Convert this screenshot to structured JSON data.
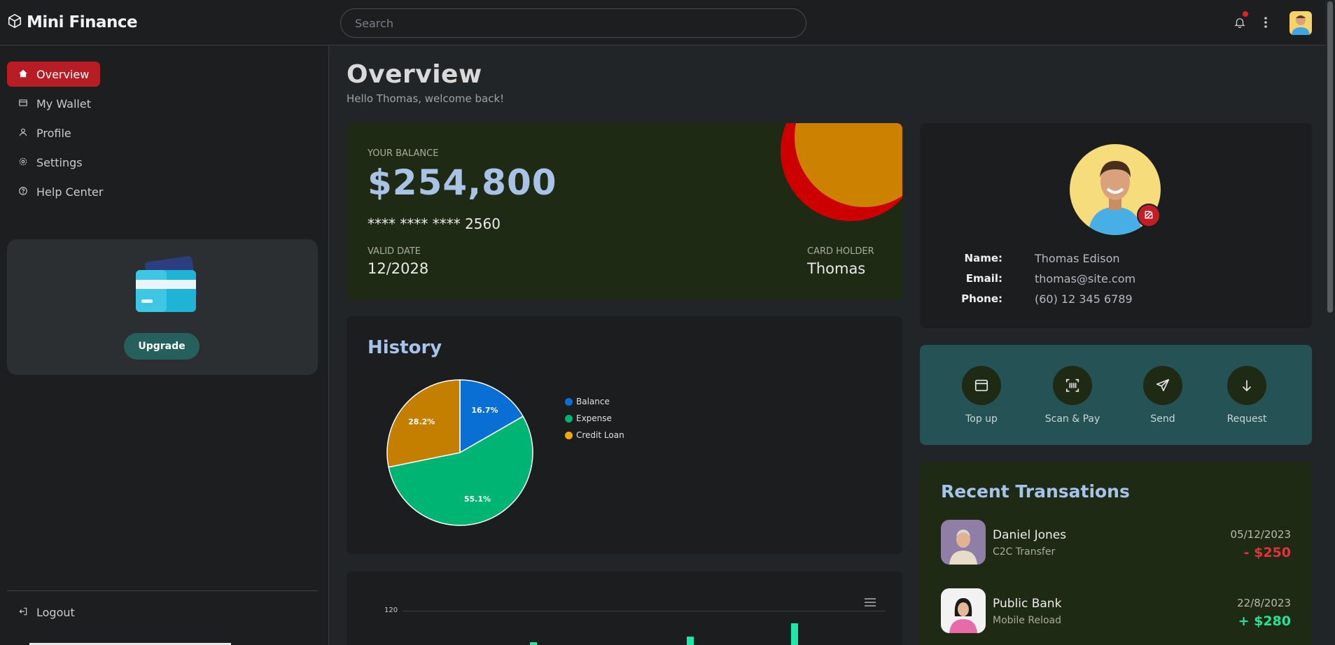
{
  "header": {
    "brand": "Mini Finance",
    "search_placeholder": "Search"
  },
  "sidebar": {
    "items": [
      {
        "label": "Overview",
        "icon": "home-icon",
        "active": true
      },
      {
        "label": "My Wallet",
        "icon": "wallet-icon"
      },
      {
        "label": "Profile",
        "icon": "user-icon"
      },
      {
        "label": "Settings",
        "icon": "gear-icon"
      },
      {
        "label": "Help Center",
        "icon": "help-icon"
      }
    ],
    "upgrade_label": "Upgrade",
    "logout_label": "Logout"
  },
  "main": {
    "title": "Overview",
    "subtitle": "Hello Thomas, welcome back!"
  },
  "balance_card": {
    "label": "YOUR BALANCE",
    "amount": "$254,800",
    "card_number": "**** **** **** 2560",
    "valid_label": "VALID DATE",
    "valid_value": "12/2028",
    "holder_label": "CARD HOLDER",
    "holder_value": "Thomas"
  },
  "history": {
    "title": "History"
  },
  "chart_data": [
    {
      "type": "pie",
      "categories": [
        "Balance",
        "Expense",
        "Credit Loan"
      ],
      "values": [
        16.7,
        55.1,
        28.2
      ],
      "labels": [
        "16.7%",
        "55.1%",
        "28.2%"
      ],
      "colors": [
        "#0a6fd4",
        "#00b574",
        "#c47e00"
      ],
      "legend": "right"
    },
    {
      "type": "bar",
      "y_tick": "120",
      "colors": [
        "#1ee8a8"
      ]
    }
  ],
  "profile": {
    "name_label": "Name:",
    "name": "Thomas Edison",
    "email_label": "Email:",
    "email": "thomas@site.com",
    "phone_label": "Phone:",
    "phone": "(60) 12 345 6789"
  },
  "actions": [
    {
      "label": "Top up",
      "icon": "window-icon"
    },
    {
      "label": "Scan & Pay",
      "icon": "barcode-scan-icon"
    },
    {
      "label": "Send",
      "icon": "send-icon"
    },
    {
      "label": "Request",
      "icon": "arrow-down-icon"
    }
  ],
  "transactions": {
    "title": "Recent Transations",
    "items": [
      {
        "name": "Daniel Jones",
        "type": "C2C Transfer",
        "date": "05/12/2023",
        "amount": "- $250",
        "color": "#e2333b"
      },
      {
        "name": "Public Bank",
        "type": "Mobile Reload",
        "date": "22/8/2023",
        "amount": "+ $280",
        "color": "#21e39c"
      }
    ]
  }
}
